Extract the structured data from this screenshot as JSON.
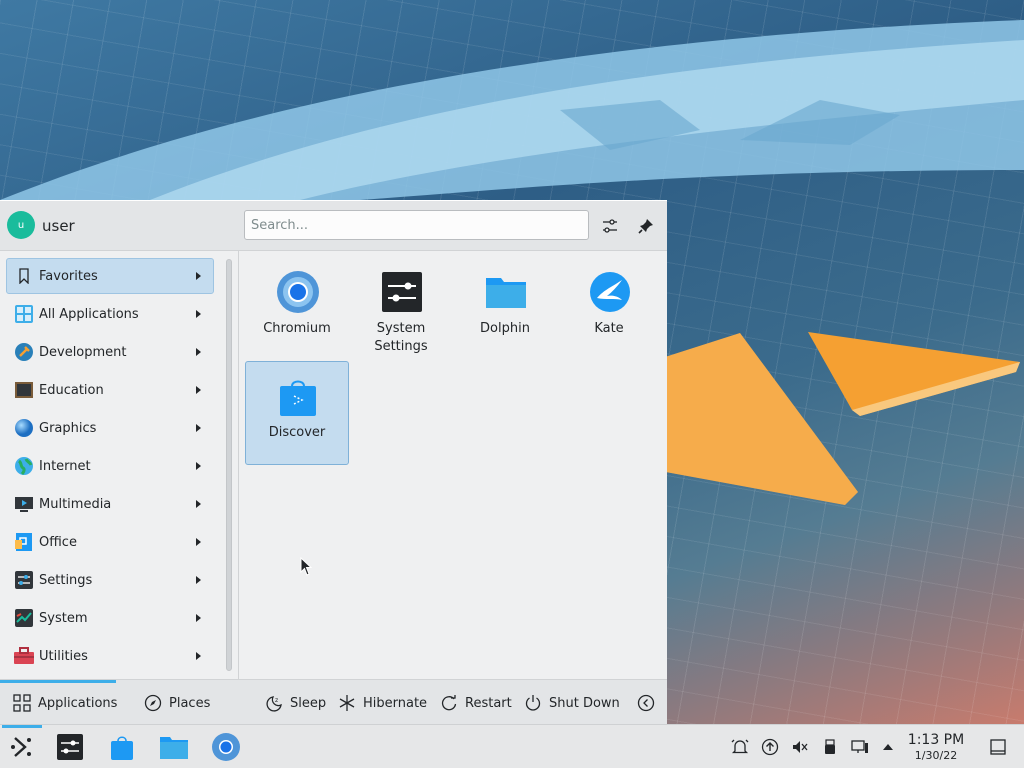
{
  "user": {
    "avatar_initial": "u",
    "name": "user"
  },
  "search": {
    "placeholder": "Search..."
  },
  "categories": [
    {
      "label": "Favorites"
    },
    {
      "label": "All Applications"
    },
    {
      "label": "Development"
    },
    {
      "label": "Education"
    },
    {
      "label": "Graphics"
    },
    {
      "label": "Internet"
    },
    {
      "label": "Multimedia"
    },
    {
      "label": "Office"
    },
    {
      "label": "Settings"
    },
    {
      "label": "System"
    },
    {
      "label": "Utilities"
    }
  ],
  "favorites": [
    {
      "name": "Chromium"
    },
    {
      "name": "System Settings"
    },
    {
      "name": "Dolphin"
    },
    {
      "name": "Kate"
    },
    {
      "name": "Discover"
    }
  ],
  "footer": {
    "tabs": {
      "applications": "Applications",
      "places": "Places"
    },
    "power": {
      "sleep": "Sleep",
      "hibernate": "Hibernate",
      "restart": "Restart",
      "shutdown": "Shut Down"
    }
  },
  "clock": {
    "time": "1:13 PM",
    "date": "1/30/22"
  },
  "colors": {
    "accent": "#3daee9",
    "selection": "#c4dcef",
    "panel": "#eff0f1"
  }
}
